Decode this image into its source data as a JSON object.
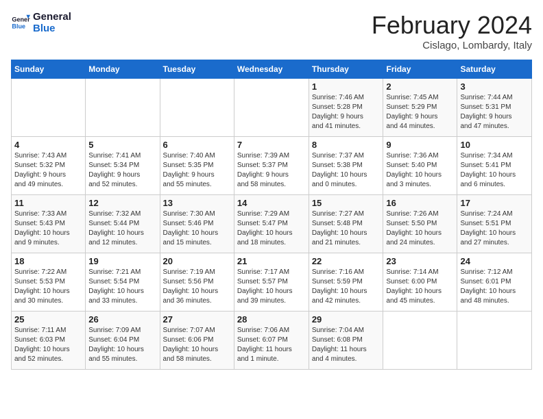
{
  "logo": {
    "line1": "General",
    "line2": "Blue"
  },
  "title": "February 2024",
  "subtitle": "Cislago, Lombardy, Italy",
  "weekdays": [
    "Sunday",
    "Monday",
    "Tuesday",
    "Wednesday",
    "Thursday",
    "Friday",
    "Saturday"
  ],
  "weeks": [
    [
      {
        "day": "",
        "info": ""
      },
      {
        "day": "",
        "info": ""
      },
      {
        "day": "",
        "info": ""
      },
      {
        "day": "",
        "info": ""
      },
      {
        "day": "1",
        "info": "Sunrise: 7:46 AM\nSunset: 5:28 PM\nDaylight: 9 hours\nand 41 minutes."
      },
      {
        "day": "2",
        "info": "Sunrise: 7:45 AM\nSunset: 5:29 PM\nDaylight: 9 hours\nand 44 minutes."
      },
      {
        "day": "3",
        "info": "Sunrise: 7:44 AM\nSunset: 5:31 PM\nDaylight: 9 hours\nand 47 minutes."
      }
    ],
    [
      {
        "day": "4",
        "info": "Sunrise: 7:43 AM\nSunset: 5:32 PM\nDaylight: 9 hours\nand 49 minutes."
      },
      {
        "day": "5",
        "info": "Sunrise: 7:41 AM\nSunset: 5:34 PM\nDaylight: 9 hours\nand 52 minutes."
      },
      {
        "day": "6",
        "info": "Sunrise: 7:40 AM\nSunset: 5:35 PM\nDaylight: 9 hours\nand 55 minutes."
      },
      {
        "day": "7",
        "info": "Sunrise: 7:39 AM\nSunset: 5:37 PM\nDaylight: 9 hours\nand 58 minutes."
      },
      {
        "day": "8",
        "info": "Sunrise: 7:37 AM\nSunset: 5:38 PM\nDaylight: 10 hours\nand 0 minutes."
      },
      {
        "day": "9",
        "info": "Sunrise: 7:36 AM\nSunset: 5:40 PM\nDaylight: 10 hours\nand 3 minutes."
      },
      {
        "day": "10",
        "info": "Sunrise: 7:34 AM\nSunset: 5:41 PM\nDaylight: 10 hours\nand 6 minutes."
      }
    ],
    [
      {
        "day": "11",
        "info": "Sunrise: 7:33 AM\nSunset: 5:43 PM\nDaylight: 10 hours\nand 9 minutes."
      },
      {
        "day": "12",
        "info": "Sunrise: 7:32 AM\nSunset: 5:44 PM\nDaylight: 10 hours\nand 12 minutes."
      },
      {
        "day": "13",
        "info": "Sunrise: 7:30 AM\nSunset: 5:46 PM\nDaylight: 10 hours\nand 15 minutes."
      },
      {
        "day": "14",
        "info": "Sunrise: 7:29 AM\nSunset: 5:47 PM\nDaylight: 10 hours\nand 18 minutes."
      },
      {
        "day": "15",
        "info": "Sunrise: 7:27 AM\nSunset: 5:48 PM\nDaylight: 10 hours\nand 21 minutes."
      },
      {
        "day": "16",
        "info": "Sunrise: 7:26 AM\nSunset: 5:50 PM\nDaylight: 10 hours\nand 24 minutes."
      },
      {
        "day": "17",
        "info": "Sunrise: 7:24 AM\nSunset: 5:51 PM\nDaylight: 10 hours\nand 27 minutes."
      }
    ],
    [
      {
        "day": "18",
        "info": "Sunrise: 7:22 AM\nSunset: 5:53 PM\nDaylight: 10 hours\nand 30 minutes."
      },
      {
        "day": "19",
        "info": "Sunrise: 7:21 AM\nSunset: 5:54 PM\nDaylight: 10 hours\nand 33 minutes."
      },
      {
        "day": "20",
        "info": "Sunrise: 7:19 AM\nSunset: 5:56 PM\nDaylight: 10 hours\nand 36 minutes."
      },
      {
        "day": "21",
        "info": "Sunrise: 7:17 AM\nSunset: 5:57 PM\nDaylight: 10 hours\nand 39 minutes."
      },
      {
        "day": "22",
        "info": "Sunrise: 7:16 AM\nSunset: 5:59 PM\nDaylight: 10 hours\nand 42 minutes."
      },
      {
        "day": "23",
        "info": "Sunrise: 7:14 AM\nSunset: 6:00 PM\nDaylight: 10 hours\nand 45 minutes."
      },
      {
        "day": "24",
        "info": "Sunrise: 7:12 AM\nSunset: 6:01 PM\nDaylight: 10 hours\nand 48 minutes."
      }
    ],
    [
      {
        "day": "25",
        "info": "Sunrise: 7:11 AM\nSunset: 6:03 PM\nDaylight: 10 hours\nand 52 minutes."
      },
      {
        "day": "26",
        "info": "Sunrise: 7:09 AM\nSunset: 6:04 PM\nDaylight: 10 hours\nand 55 minutes."
      },
      {
        "day": "27",
        "info": "Sunrise: 7:07 AM\nSunset: 6:06 PM\nDaylight: 10 hours\nand 58 minutes."
      },
      {
        "day": "28",
        "info": "Sunrise: 7:06 AM\nSunset: 6:07 PM\nDaylight: 11 hours\nand 1 minute."
      },
      {
        "day": "29",
        "info": "Sunrise: 7:04 AM\nSunset: 6:08 PM\nDaylight: 11 hours\nand 4 minutes."
      },
      {
        "day": "",
        "info": ""
      },
      {
        "day": "",
        "info": ""
      }
    ]
  ]
}
